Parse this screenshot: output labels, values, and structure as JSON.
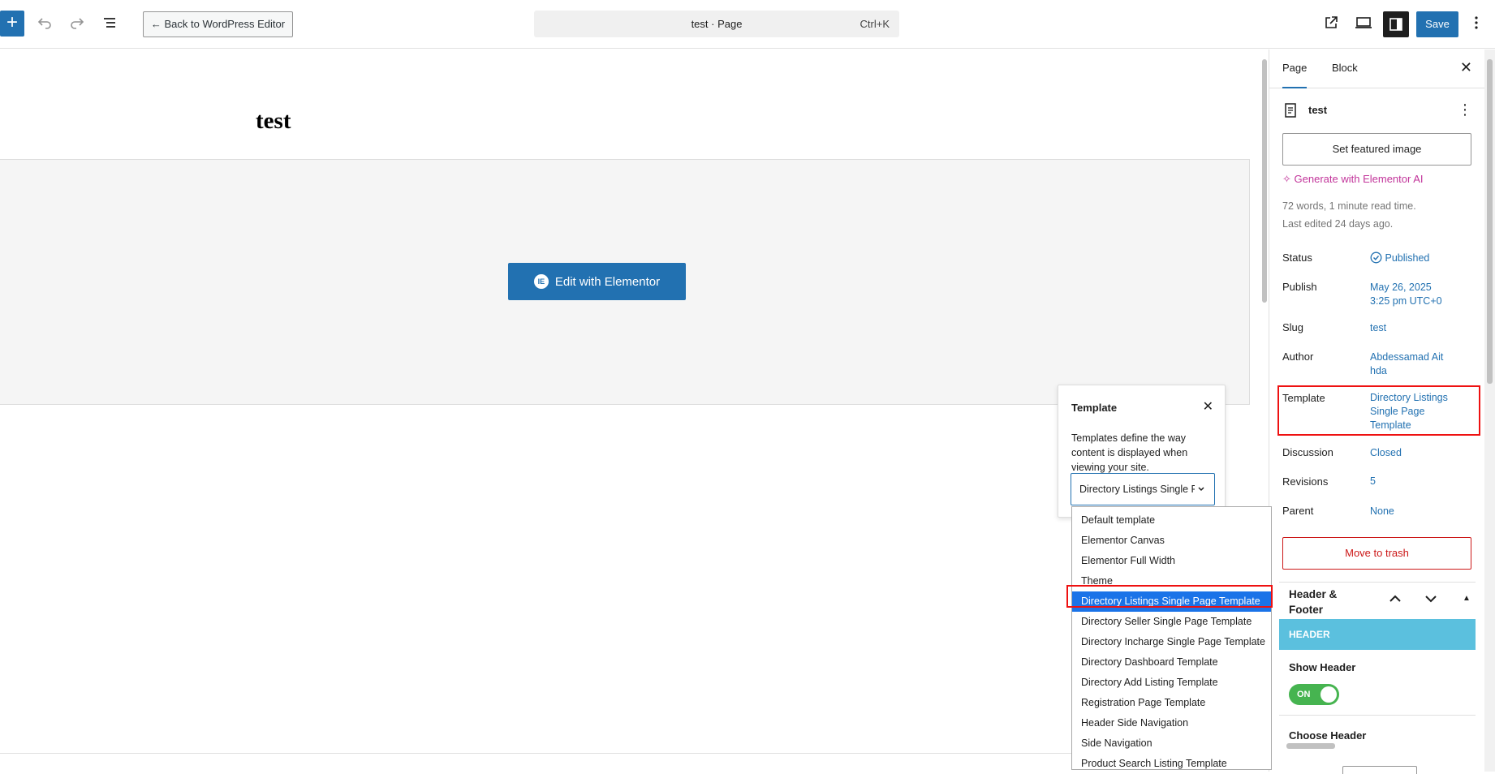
{
  "header": {
    "back_label": "← Back to WordPress Editor",
    "command_title": "test · Page",
    "command_shortcut": "Ctrl+K",
    "save_label": "Save"
  },
  "canvas": {
    "page_title": "test",
    "elementor_button": "Edit with Elementor"
  },
  "sidebar": {
    "tabs": [
      "Page",
      "Block"
    ],
    "doc_title": "test",
    "featured_image_label": "Set featured image",
    "generate_ai_label": "Generate with Elementor AI",
    "word_count": "72 words, 1 minute read time.",
    "last_edited": "Last edited 24 days ago.",
    "props": {
      "status_label": "Status",
      "status_value": "Published",
      "publish_label": "Publish",
      "publish_value_1": "May 26, 2025",
      "publish_value_2": "3:25 pm UTC+0",
      "slug_label": "Slug",
      "slug_value": "test",
      "author_label": "Author",
      "author_value_1": "Abdessamad Ait",
      "author_value_2": "hda",
      "template_label": "Template",
      "template_value_1": "Directory Listings",
      "template_value_2": "Single Page",
      "template_value_3": "Template",
      "discussion_label": "Discussion",
      "discussion_value": "Closed",
      "revisions_label": "Revisions",
      "revisions_value": "5",
      "parent_label": "Parent",
      "parent_value": "None"
    },
    "trash_label": "Move to trash",
    "header_footer": {
      "title": "Header & Footer",
      "bar_label": "HEADER",
      "show_header_label": "Show Header",
      "toggle_label": "ON",
      "choose_header_label": "Choose Header"
    }
  },
  "template_popover": {
    "title": "Template",
    "description": "Templates define the way content is displayed when viewing your site.",
    "selected_value": "Directory Listings Single Page Template",
    "options": [
      "Default template",
      "Elementor Canvas",
      "Elementor Full Width",
      "Theme",
      "Directory Listings Single Page Template",
      "Directory Seller Single Page Template",
      "Directory Incharge Single Page Template",
      "Directory Dashboard Template",
      "Directory Add Listing Template",
      "Registration Page Template",
      "Header Side Navigation",
      "Side Navigation",
      "Product Search Listing Template"
    ],
    "selected_index": 4
  },
  "colors": {
    "accent": "#2271b1",
    "ai_pink": "#c2349a",
    "danger": "#cc1818",
    "header_bar": "#5bc0de",
    "toggle_on": "#46b450",
    "option_selected": "#1a73e8",
    "highlight_box": "#ee1111"
  },
  "icons": [
    "plus-icon",
    "undo-icon",
    "redo-icon",
    "list-view-icon",
    "external-link-icon",
    "desktop-preview-icon",
    "sidebar-icon",
    "options-icon",
    "close-icon",
    "page-icon",
    "sparkle-icon",
    "check-circle-icon",
    "chevron-down-icon",
    "chevron-up-icon",
    "caret-up-icon"
  ]
}
